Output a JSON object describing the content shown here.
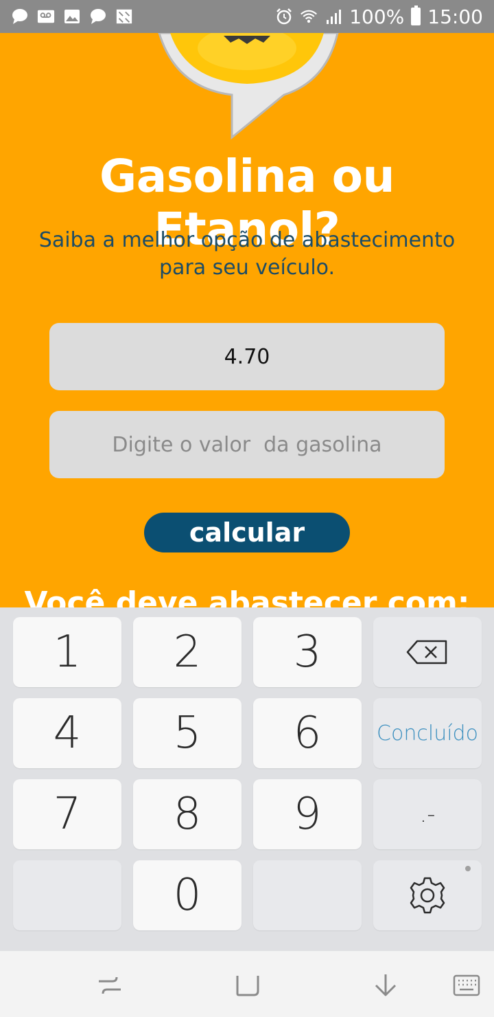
{
  "status_bar": {
    "battery": "100%",
    "time": "15:00",
    "icons": [
      "chat-icon",
      "voicemail-icon",
      "image-icon",
      "chat-icon",
      "grid-icon",
      "alarm-icon",
      "wifi-icon",
      "signal-icon",
      "battery-icon"
    ]
  },
  "app": {
    "title": "Gasolina ou Etanol?",
    "subtitle": "Saiba a melhor opção de abastecimento para seu veículo.",
    "field1_value": "4.70",
    "field2_placeholder": "Digite o valor  da gasolina",
    "calculate_label": "calcular",
    "result_label": "Você deve abastecer com:"
  },
  "keyboard": {
    "keys": [
      "1",
      "2",
      "3",
      "4",
      "5",
      "6",
      "7",
      "8",
      "9",
      "0"
    ],
    "done_label": "Concluído",
    "punct_label": ".-"
  },
  "colors": {
    "background": "#ffa500",
    "primary": "#0b4f72",
    "subtitle": "#1c4c66",
    "done": "#3b8fbf"
  }
}
